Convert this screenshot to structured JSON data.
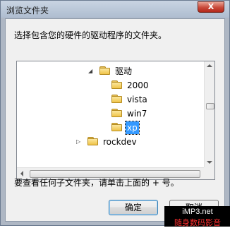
{
  "window": {
    "title": "浏览文件夹",
    "close_glyph": "X"
  },
  "dialog": {
    "instruction": "选择包含您的硬件的驱动程序的文件夹。",
    "hint": "要查看任何子文件夹，请单击上面的 + 号。"
  },
  "tree": {
    "items": [
      {
        "label": "驱动",
        "level": 1,
        "expander": "◢",
        "expanded": true,
        "selected": false
      },
      {
        "label": "2000",
        "level": 2,
        "expander": "",
        "expanded": false,
        "selected": false
      },
      {
        "label": "vista",
        "level": 2,
        "expander": "",
        "expanded": false,
        "selected": false
      },
      {
        "label": "win7",
        "level": 2,
        "expander": "",
        "expanded": false,
        "selected": false
      },
      {
        "label": "xp",
        "level": 2,
        "expander": "",
        "expanded": false,
        "selected": true
      },
      {
        "label": "rockdev",
        "level": 0,
        "expander": "▷",
        "expanded": false,
        "selected": false
      }
    ]
  },
  "buttons": {
    "ok": "确定",
    "cancel": "取消"
  },
  "watermark": {
    "line1": "iMP3.net",
    "line2": "随身数码影音"
  },
  "colors": {
    "selection": "#3399ff",
    "titlebar": "#b9c6d6",
    "close": "#c8493a"
  }
}
